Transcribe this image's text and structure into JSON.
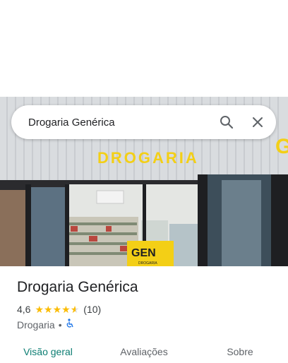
{
  "search": {
    "query": "Drogaria Genérica"
  },
  "hero": {
    "sign_text": "DROGARIA",
    "logo_text": "GEN",
    "logo_subtext": "DROGARIA"
  },
  "place": {
    "name": "Drogaria Genérica",
    "rating": "4,6",
    "rating_value": 4.6,
    "review_count": "(10)",
    "category": "Drogaria",
    "separator": "•"
  },
  "tabs": [
    {
      "label": "Visão geral",
      "active": true
    },
    {
      "label": "Avaliações",
      "active": false
    },
    {
      "label": "Sobre",
      "active": false
    }
  ],
  "colors": {
    "accent": "#0b7d72",
    "star": "#fbbc04",
    "accessible": "#1a73e8",
    "sign_yellow": "#f3cf16"
  }
}
